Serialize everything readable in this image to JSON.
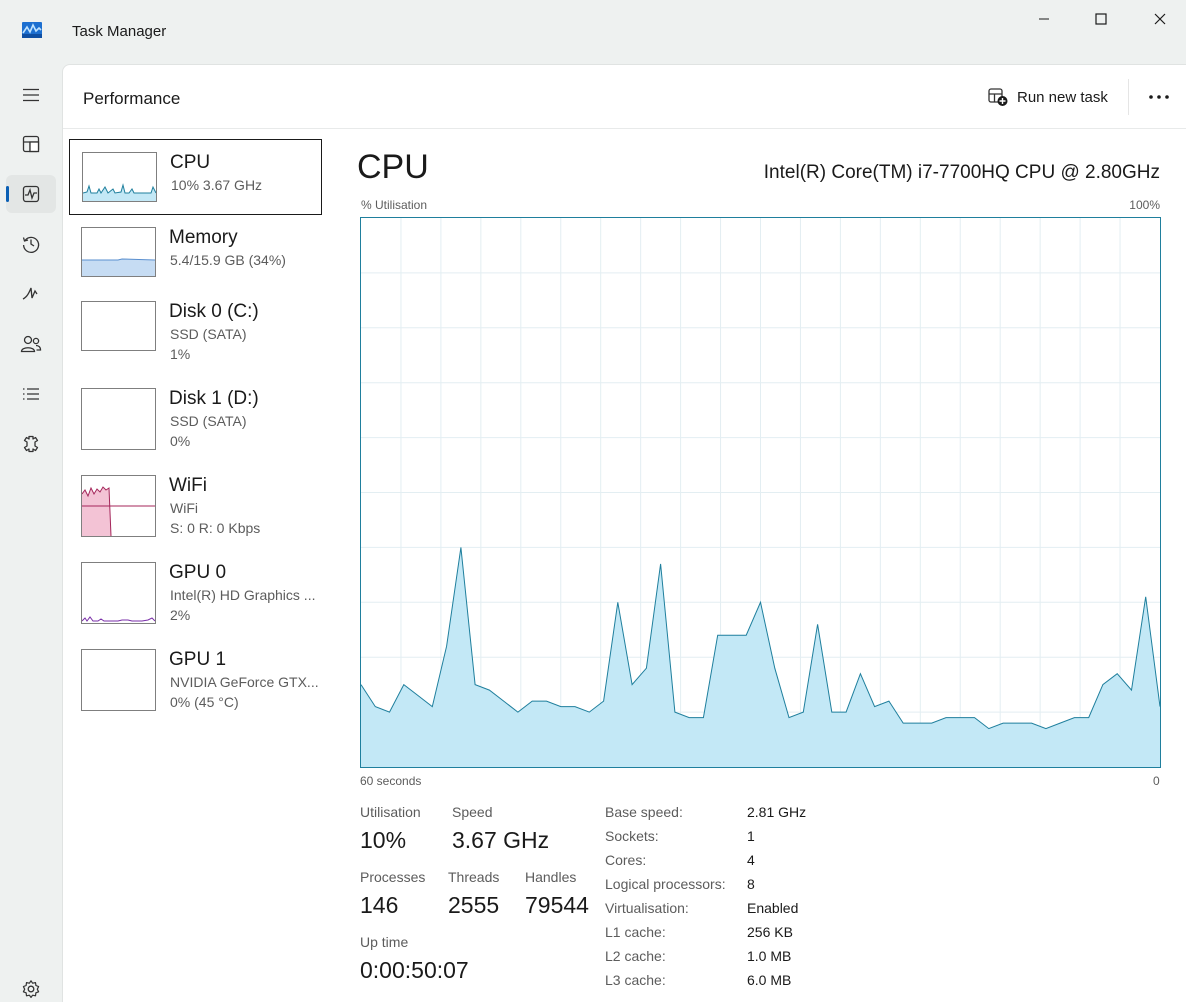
{
  "window": {
    "title": "Task Manager"
  },
  "header": {
    "title": "Performance",
    "run_new_task": "Run new task"
  },
  "resources": [
    {
      "name": "CPU",
      "line1": "10%  3.67 GHz",
      "line2": ""
    },
    {
      "name": "Memory",
      "line1": "5.4/15.9 GB (34%)",
      "line2": ""
    },
    {
      "name": "Disk 0 (C:)",
      "line1": "SSD (SATA)",
      "line2": "1%"
    },
    {
      "name": "Disk 1 (D:)",
      "line1": "SSD (SATA)",
      "line2": "0%"
    },
    {
      "name": "WiFi",
      "line1": "WiFi",
      "line2": "S: 0 R: 0 Kbps"
    },
    {
      "name": "GPU 0",
      "line1": "Intel(R) HD Graphics ...",
      "line2": "2%"
    },
    {
      "name": "GPU 1",
      "line1": "NVIDIA GeForce GTX...",
      "line2": "0% (45 °C)"
    }
  ],
  "detail": {
    "title": "CPU",
    "model": "Intel(R) Core(TM) i7-7700HQ CPU @ 2.80GHz",
    "graph_label_left": "% Utilisation",
    "graph_label_right": "100%",
    "axis_left": "60 seconds",
    "axis_right": "0"
  },
  "stats": {
    "utilisation_label": "Utilisation",
    "utilisation": "10%",
    "speed_label": "Speed",
    "speed": "3.67 GHz",
    "processes_label": "Processes",
    "processes": "146",
    "threads_label": "Threads",
    "threads": "2555",
    "handles_label": "Handles",
    "handles": "79544",
    "uptime_label": "Up time",
    "uptime": "0:00:50:07"
  },
  "specs": [
    {
      "label": "Base speed:",
      "value": "2.81 GHz"
    },
    {
      "label": "Sockets:",
      "value": "1"
    },
    {
      "label": "Cores:",
      "value": "4"
    },
    {
      "label": "Logical processors:",
      "value": "8"
    },
    {
      "label": "Virtualisation:",
      "value": "Enabled"
    },
    {
      "label": "L1 cache:",
      "value": "256 KB"
    },
    {
      "label": "L2 cache:",
      "value": "1.0 MB"
    },
    {
      "label": "L3 cache:",
      "value": "6.0 MB"
    }
  ],
  "cpu_history": [
    15,
    11,
    10,
    15,
    13,
    11,
    22,
    40,
    15,
    14,
    12,
    10,
    12,
    12,
    11,
    11,
    10,
    12,
    30,
    15,
    18,
    37,
    10,
    9,
    9,
    24,
    24,
    24,
    30,
    18,
    9,
    10,
    26,
    10,
    10,
    17,
    11,
    12,
    8,
    8,
    8,
    9,
    9,
    9,
    7,
    8,
    8,
    8,
    7,
    8,
    9,
    9,
    15,
    17,
    14,
    31,
    11
  ],
  "colors": {
    "cpu": "#1f7f9d",
    "cpu_fill": "#c3e8f6",
    "memory": "#5a8fcf",
    "disk": "#4d8a12",
    "wifi": "#a4265a",
    "gpu": "#7a2fa8",
    "accent": "#0a5fb4"
  },
  "icons": {
    "app": "task-manager-icon",
    "rail": [
      "hamburger-icon",
      "processes-icon",
      "performance-icon",
      "app-history-icon",
      "startup-apps-icon",
      "users-icon",
      "details-icon",
      "services-icon"
    ],
    "settings": "settings-gear-icon"
  }
}
